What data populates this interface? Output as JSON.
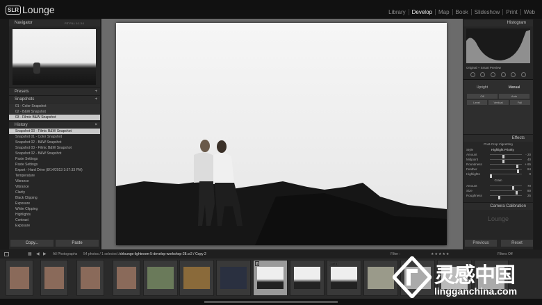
{
  "app": {
    "logo_box": "SLR",
    "logo_text": "Lounge"
  },
  "modules": [
    "Library",
    "Develop",
    "Map",
    "Book",
    "Slideshow",
    "Print",
    "Web"
  ],
  "active_module": "Develop",
  "left": {
    "navigator": {
      "title": "Navigator",
      "zoom": [
        "FIT",
        "FILL",
        "1:1",
        "3:1"
      ]
    },
    "presets": {
      "title": "Presets"
    },
    "snapshots": {
      "title": "Snapshots",
      "items": [
        "01 - Color Snapshot",
        "02 - B&W Snapshot",
        "03 - Filmic B&W Snapshot"
      ],
      "selected": 2
    },
    "history": {
      "title": "History",
      "items": [
        {
          "label": "Snapshot 03 - Filmic B&W Snapshot",
          "value": ""
        },
        {
          "label": "Snapshot 01 - Color Snapshot",
          "value": ""
        },
        {
          "label": "Snapshot 02 - B&W Snapshot",
          "value": ""
        },
        {
          "label": "Snapshot 03 - Filmic B&W Snapshot",
          "value": ""
        },
        {
          "label": "Snapshot 02 - B&W Snapshot",
          "value": ""
        },
        {
          "label": "Paste Settings",
          "value": ""
        },
        {
          "label": "Paste Settings",
          "value": ""
        },
        {
          "label": "Export - Hard Drive (8/14/2013 3:57:33 PM)",
          "value": ""
        },
        {
          "label": "Temperature",
          "value": ""
        },
        {
          "label": "Vibrance",
          "value": ""
        },
        {
          "label": "Vibrance",
          "value": ""
        },
        {
          "label": "Clarity",
          "value": ""
        },
        {
          "label": "Black Clipping",
          "value": ""
        },
        {
          "label": "Exposure",
          "value": ""
        },
        {
          "label": "White Clipping",
          "value": ""
        },
        {
          "label": "Highlights",
          "value": ""
        },
        {
          "label": "Contrast",
          "value": ""
        },
        {
          "label": "Exposure",
          "value": ""
        }
      ]
    },
    "copy_btn": "Copy...",
    "paste_btn": "Paste"
  },
  "right": {
    "histogram": {
      "title": "Histogram",
      "readout": "",
      "original": "Original + Smart Preview"
    },
    "upright": {
      "tabs": [
        "Upright",
        "Manual"
      ],
      "buttons": [
        "Off",
        "Auto",
        "Level",
        "Vertical",
        "Full"
      ],
      "text": ""
    },
    "effects": {
      "title": "Effects",
      "vignette_title": "Post-Crop Vignetting",
      "style_label": "Style",
      "style_value": "Highlight Priority",
      "sliders": [
        {
          "label": "Amount",
          "value": "- 20",
          "pos": 0.4
        },
        {
          "label": "Midpoint",
          "value": "40",
          "pos": 0.4
        },
        {
          "label": "Roundness",
          "value": "+ 65",
          "pos": 0.82
        },
        {
          "label": "Feather",
          "value": "84",
          "pos": 0.84
        },
        {
          "label": "Highlights",
          "value": "0",
          "pos": 0.0
        }
      ],
      "grain_title": "Grain",
      "grain": [
        {
          "label": "Amount",
          "value": "70",
          "pos": 0.7
        },
        {
          "label": "Size",
          "value": "80",
          "pos": 0.8
        },
        {
          "label": "Roughness",
          "value": "25",
          "pos": 0.25
        }
      ]
    },
    "calibration": {
      "title": "Camera Calibration"
    },
    "logo_text": "Lounge",
    "previous_btn": "Previous",
    "reset_btn": "Reset"
  },
  "filmbar": {
    "source": "All Photographs",
    "count": "54 photos / 1 selected /",
    "file": "slrlounge-lightroom-5-develop-workshop-28.cr2 / Copy 2",
    "filter_label": "Filter :",
    "filters_off": "Filters Off"
  },
  "filmstrip": {
    "badges": [
      "1",
      "1 of 3"
    ]
  },
  "watermark": {
    "cn": "灵感中国",
    "url": "lingganchina.com"
  },
  "colors": {
    "accent": "#dddddd",
    "panel": "#262626",
    "selected_row": "#c9c9c9"
  }
}
